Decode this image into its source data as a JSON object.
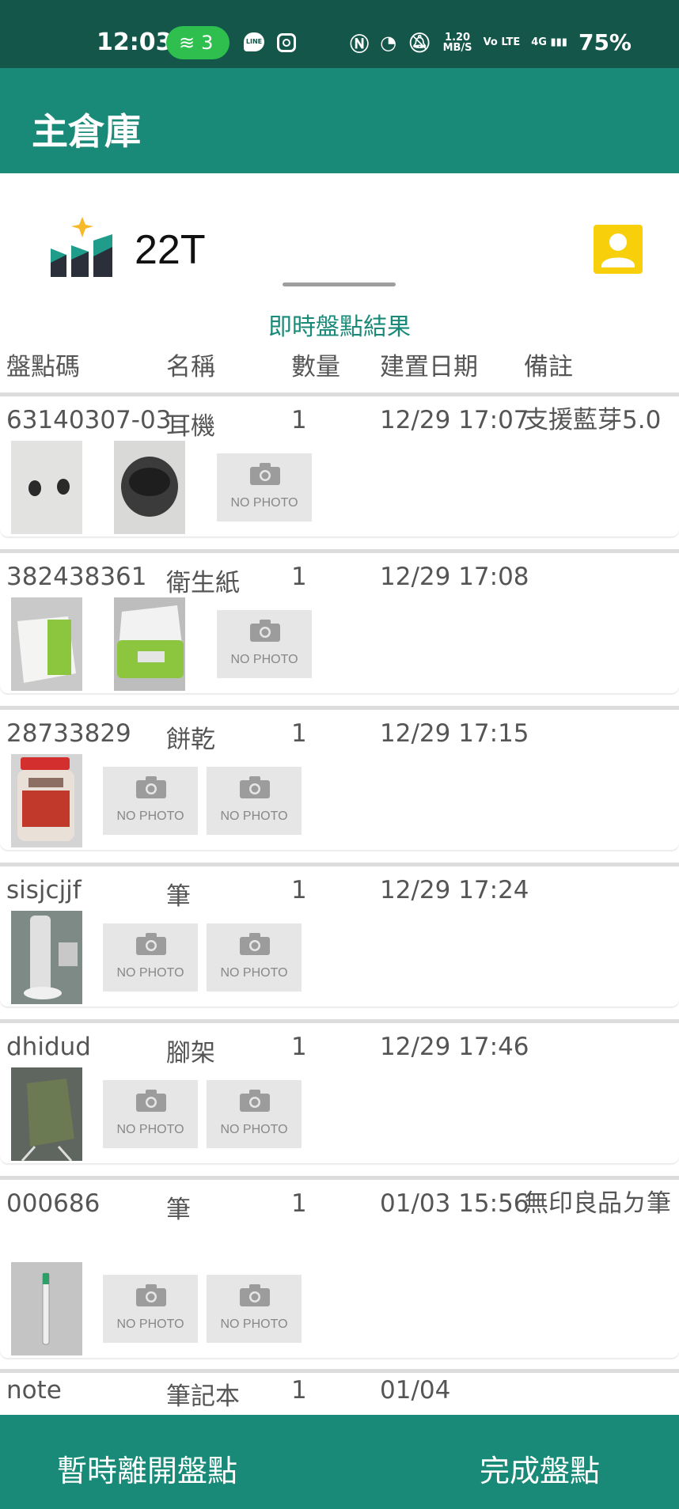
{
  "status_bar": {
    "time": "12:03",
    "hotspot_count": "3",
    "line_label": "LINE",
    "speed_value": "1.20",
    "speed_unit": "MB/S",
    "volte": "Vo LTE",
    "network": "4G",
    "battery": "75%"
  },
  "app_bar": {
    "title": "主倉庫"
  },
  "store": {
    "name": "22T"
  },
  "section_title": "即時盤點結果",
  "columns": {
    "code": "盤點碼",
    "name": "名稱",
    "qty": "數量",
    "date": "建置日期",
    "note": "備註"
  },
  "no_photo_label": "NO PHOTO",
  "rows": [
    {
      "code": "63140307-03",
      "name": "耳機",
      "qty": "1",
      "date": "12/29 17:07",
      "note": "支援藍芽5.0"
    },
    {
      "code": "382438361",
      "name": "衛生紙",
      "qty": "1",
      "date": "12/29 17:08",
      "note": ""
    },
    {
      "code": "28733829",
      "name": "餅乾",
      "qty": "1",
      "date": "12/29 17:15",
      "note": ""
    },
    {
      "code": "sisjcjjf",
      "name": "筆",
      "qty": "1",
      "date": "12/29 17:24",
      "note": ""
    },
    {
      "code": "dhidud",
      "name": "腳架",
      "qty": "1",
      "date": "12/29 17:46",
      "note": ""
    },
    {
      "code": "000686",
      "name": "筆",
      "qty": "1",
      "date": "01/03 15:56",
      "note": "無印良品ㄉ筆"
    },
    {
      "code": "note",
      "name": "筆記本",
      "qty": "1",
      "date": "01/04",
      "note": ""
    }
  ],
  "bottom_bar": {
    "left_button": "暫時離開盤點",
    "right_button": "完成盤點"
  },
  "colors": {
    "status_bar": "#14574a",
    "primary": "#1a8a78",
    "accent_yellow": "#f7cf0a",
    "section_title": "#1a8a78"
  }
}
